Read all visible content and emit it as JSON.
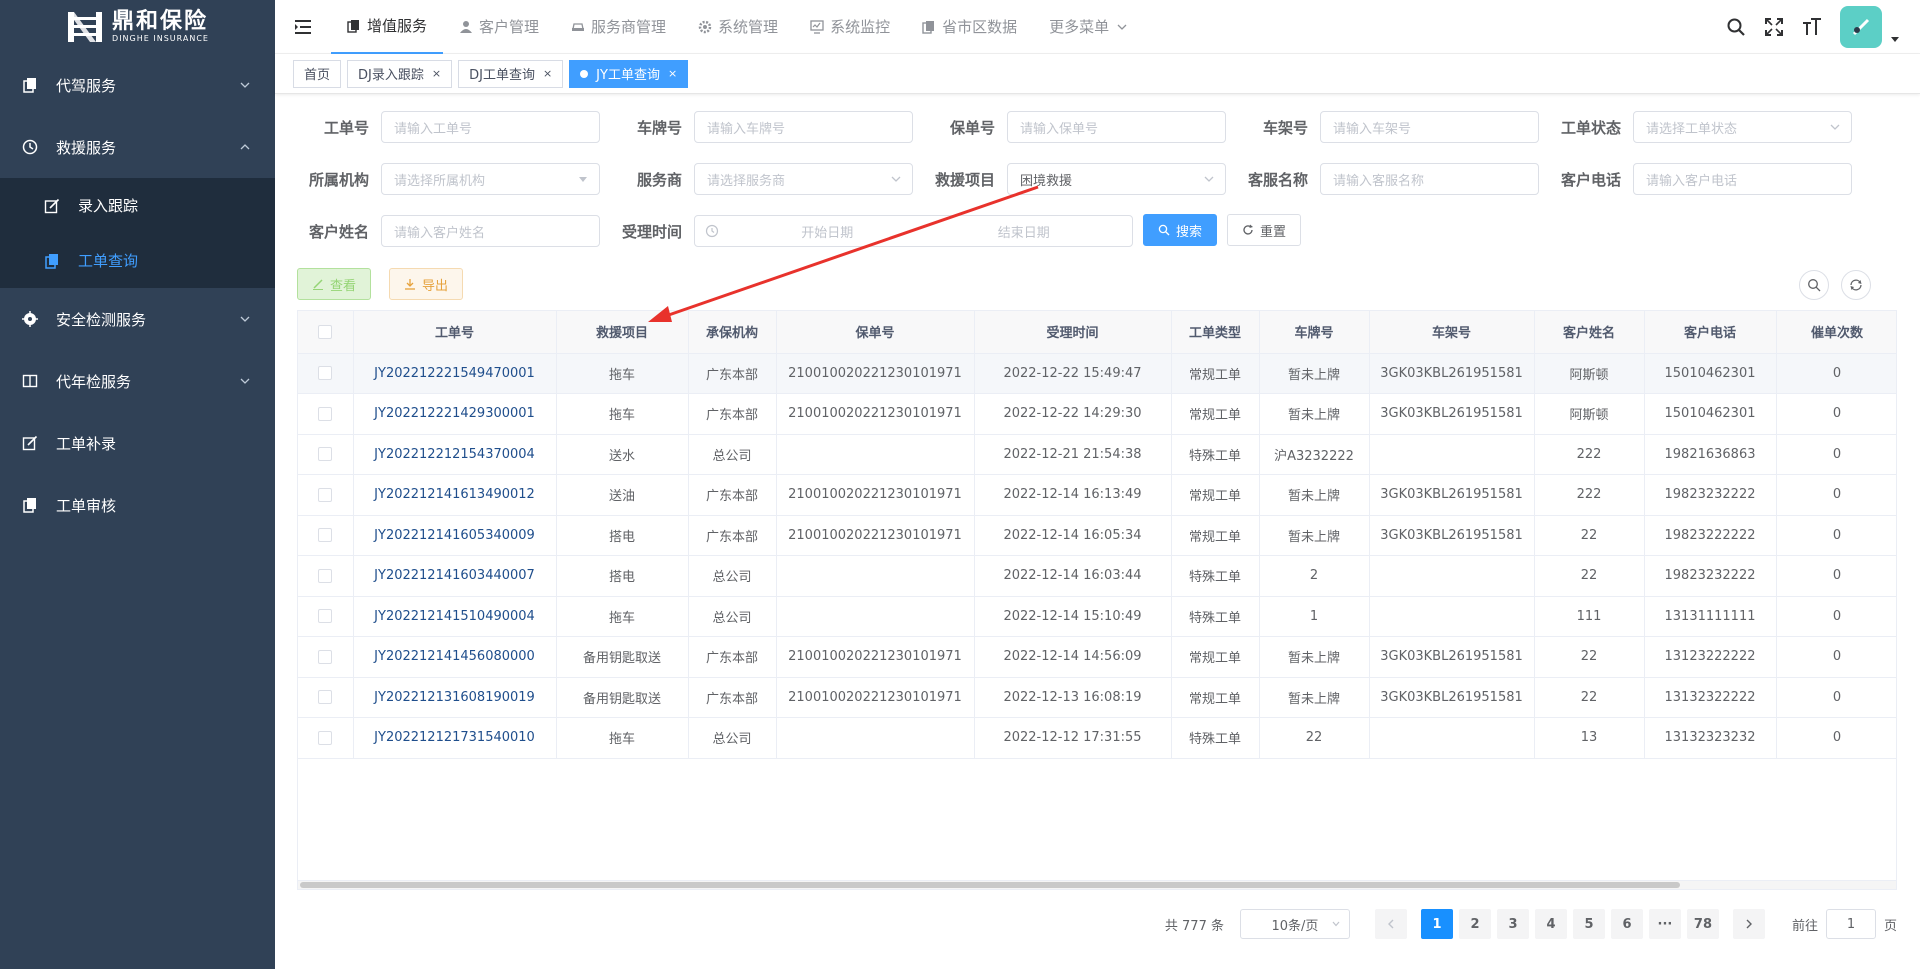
{
  "logo": {
    "cn": "鼎和保险",
    "en": "DINGHE INSURANCE"
  },
  "sidebar": {
    "items": [
      {
        "label": "代驾服务",
        "icon": "copy-icon",
        "expanded": false
      },
      {
        "label": "救援服务",
        "icon": "clock-icon",
        "expanded": true
      },
      {
        "label": "录入跟踪",
        "icon": "edit-icon",
        "sub": true
      },
      {
        "label": "工单查询",
        "icon": "copy-icon",
        "sub": true,
        "active": true
      },
      {
        "label": "安全检测服务",
        "icon": "aim-icon",
        "expanded": false
      },
      {
        "label": "代年检服务",
        "icon": "book-icon",
        "expanded": false
      },
      {
        "label": "工单补录",
        "icon": "edit-icon"
      },
      {
        "label": "工单审核",
        "icon": "copy-icon"
      }
    ]
  },
  "topnav": {
    "items": [
      {
        "label": "增值服务",
        "icon": "copy-icon",
        "active": true
      },
      {
        "label": "客户管理",
        "icon": "user-icon"
      },
      {
        "label": "服务商管理",
        "icon": "car-icon"
      },
      {
        "label": "系统管理",
        "icon": "gear-icon"
      },
      {
        "label": "系统监控",
        "icon": "monitor-icon"
      },
      {
        "label": "省市区数据",
        "icon": "copy-icon"
      },
      {
        "label": "更多菜单",
        "icon": "chevron-down-icon"
      }
    ]
  },
  "tags": [
    {
      "label": "首页",
      "closable": false
    },
    {
      "label": "DJ录入跟踪",
      "closable": true
    },
    {
      "label": "DJ工单查询",
      "closable": true
    },
    {
      "label": "JY工单查询",
      "closable": true,
      "active": true
    }
  ],
  "form": {
    "fields": [
      {
        "label": "工单号",
        "placeholder": "请输入工单号"
      },
      {
        "label": "车牌号",
        "placeholder": "请输入车牌号"
      },
      {
        "label": "保单号",
        "placeholder": "请输入保单号"
      },
      {
        "label": "车架号",
        "placeholder": "请输入车架号"
      },
      {
        "label": "工单状态",
        "placeholder": "请选择工单状态",
        "select": true
      },
      {
        "label": "所属机构",
        "placeholder": "请选择所属机构",
        "select": true
      },
      {
        "label": "服务商",
        "placeholder": "请选择服务商",
        "select": true
      },
      {
        "label": "救援项目",
        "value": "困境救援",
        "select": true
      },
      {
        "label": "客服名称",
        "placeholder": "请输入客服名称"
      },
      {
        "label": "客户电话",
        "placeholder": "请输入客户电话"
      },
      {
        "label": "客户姓名",
        "placeholder": "请输入客户姓名"
      }
    ],
    "date_label": "受理时间",
    "date_start": "开始日期",
    "date_end": "结束日期",
    "search_label": "搜索",
    "reset_label": "重置"
  },
  "toolbar": {
    "view_label": "查看",
    "export_label": "导出"
  },
  "table": {
    "columns": [
      "",
      "工单号",
      "救援项目",
      "承保机构",
      "保单号",
      "受理时间",
      "工单类型",
      "车牌号",
      "车架号",
      "客户姓名",
      "客户电话",
      "催单次数"
    ],
    "rows": [
      [
        "JY202212221549470001",
        "拖车",
        "广东本部",
        "210010020221230101971",
        "2022-12-22 15:49:47",
        "常规工单",
        "暂未上牌",
        "3GK03KBL261951581",
        "阿斯顿",
        "15010462301",
        "0"
      ],
      [
        "JY202212221429300001",
        "拖车",
        "广东本部",
        "210010020221230101971",
        "2022-12-22 14:29:30",
        "常规工单",
        "暂未上牌",
        "3GK03KBL261951581",
        "阿斯顿",
        "15010462301",
        "0"
      ],
      [
        "JY2022122121543700​04",
        "送水",
        "总公司",
        "",
        "2022-12-21 21:54:38",
        "特殊工单",
        "沪A3232222",
        "",
        "222",
        "19821636863",
        "0"
      ],
      [
        "JY202212141613490012",
        "送油",
        "广东本部",
        "210010020221230101971",
        "2022-12-14 16:13:49",
        "常规工单",
        "暂未上牌",
        "3GK03KBL261951581",
        "222",
        "19823232222",
        "0"
      ],
      [
        "JY202212141605340009",
        "搭电",
        "广东本部",
        "210010020221230101971",
        "2022-12-14 16:05:34",
        "常规工单",
        "暂未上牌",
        "3GK03KBL261951581",
        "22",
        "19823222222",
        "0"
      ],
      [
        "JY202212141603440007",
        "搭电",
        "总公司",
        "",
        "2022-12-14 16:03:44",
        "特殊工单",
        "2",
        "",
        "22",
        "19823232222",
        "0"
      ],
      [
        "JY202212141510490004",
        "拖车",
        "总公司",
        "",
        "2022-12-14 15:10:49",
        "特殊工单",
        "1",
        "",
        "111",
        "13131111111",
        "0"
      ],
      [
        "JY202212141456080000",
        "备用钥匙取送",
        "广东本部",
        "210010020221230101971",
        "2022-12-14 14:56:09",
        "常规工单",
        "暂未上牌",
        "3GK03KBL261951581",
        "22",
        "13123222222",
        "0"
      ],
      [
        "JY202212131608190019",
        "备用钥匙取送",
        "广东本部",
        "210010020221230101971",
        "2022-12-13 16:08:19",
        "常规工单",
        "暂未上牌",
        "3GK03KBL261951581",
        "22",
        "13132322222",
        "0"
      ],
      [
        "JY202212121731540010",
        "拖车",
        "总公司",
        "",
        "2022-12-12 17:31:55",
        "特殊工单",
        "22",
        "",
        "13",
        "13132323232",
        "0"
      ]
    ]
  },
  "pager": {
    "total": "共 777 条",
    "size": "10条/页",
    "pages": [
      "1",
      "2",
      "3",
      "4",
      "5",
      "6",
      "···",
      "78"
    ],
    "current": "1",
    "goto_label": "前往",
    "goto_value": "1",
    "page_suffix": "页"
  },
  "colors": {
    "sidebar_bg": "#304156",
    "primary": "#409eff",
    "annotation": "#e8322c"
  }
}
